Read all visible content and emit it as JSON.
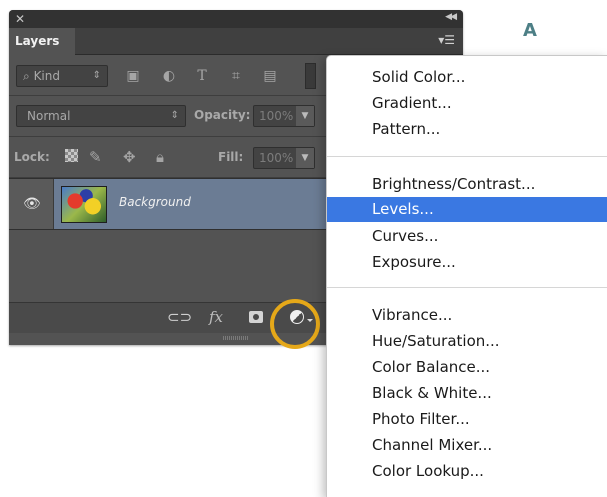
{
  "callout": {
    "label": "A"
  },
  "layers_panel": {
    "tab_label": "Layers",
    "filter": {
      "kind_label": "Kind",
      "icons": [
        "image-filter-icon",
        "adjustment-filter-icon",
        "type-filter-icon",
        "shape-filter-icon",
        "smart-object-filter-icon"
      ]
    },
    "blend_mode": "Normal",
    "opacity_label": "Opacity:",
    "opacity_value": "100%",
    "lock_label": "Lock:",
    "fill_label": "Fill:",
    "fill_value": "100%",
    "layers": [
      {
        "name": "Background",
        "visible": true,
        "selected": true
      }
    ],
    "bottom_icons": [
      "link-layers-icon",
      "fx-icon",
      "add-mask-icon",
      "new-adjustment-layer-icon"
    ],
    "fx_label": "fx"
  },
  "adjustment_menu": {
    "groups": [
      [
        "Solid Color...",
        "Gradient...",
        "Pattern..."
      ],
      [
        "Brightness/Contrast...",
        "Levels...",
        "Curves...",
        "Exposure..."
      ],
      [
        "Vibrance...",
        "Hue/Saturation...",
        "Color Balance...",
        "Black & White...",
        "Photo Filter...",
        "Channel Mixer...",
        "Color Lookup..."
      ]
    ],
    "highlighted_item": "Levels..."
  },
  "colors": {
    "panel_bg": "#535353",
    "selected_layer": "#6b7c94",
    "menu_highlight": "#3a78e2",
    "highlight_ring": "#e5a819",
    "callout_text": "#4d7f86"
  }
}
